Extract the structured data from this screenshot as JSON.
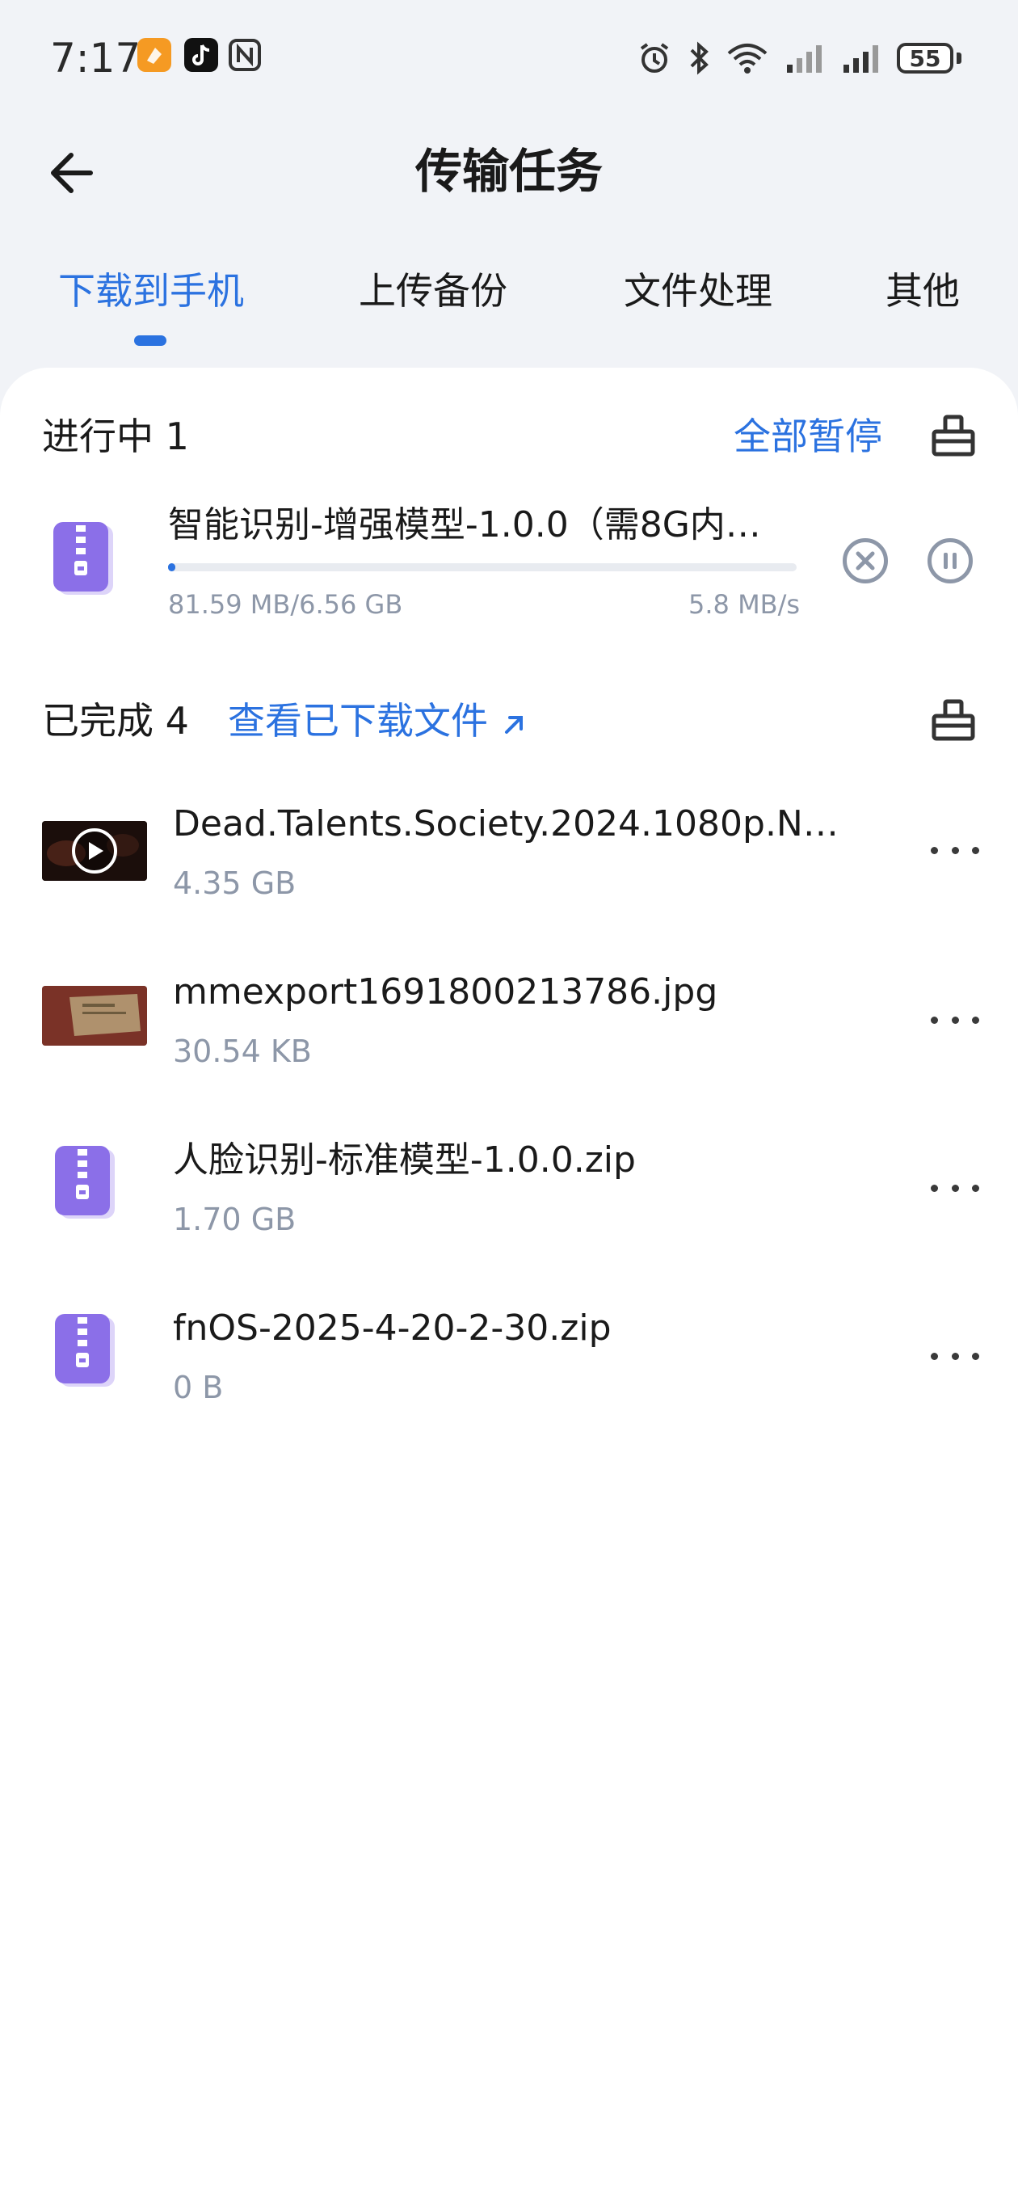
{
  "status_bar": {
    "time": "7:17",
    "battery": "55",
    "icons": [
      "alarm-icon",
      "bluetooth-icon",
      "wifi-icon",
      "signal-icon",
      "signal-icon"
    ]
  },
  "header": {
    "title": "传输任务",
    "back_icon": "arrow-left-icon"
  },
  "tabs": [
    {
      "label": "下载到手机",
      "active": true
    },
    {
      "label": "上传备份",
      "active": false
    },
    {
      "label": "文件处理",
      "active": false
    },
    {
      "label": "其他",
      "active": false
    }
  ],
  "in_progress": {
    "label": "进行中 1",
    "pause_all": "全部暂停",
    "items": [
      {
        "name": "智能识别-增强模型-1.0.0（需8G内…",
        "progress_text": "81.59 MB/6.56 GB",
        "speed": "5.8 MB/s",
        "progress_fraction": 0.012
      }
    ]
  },
  "completed": {
    "label": "已完成 4",
    "view_link": "查看已下载文件",
    "items": [
      {
        "name": "Dead.Talents.Society.2024.1080p.N…",
        "size": "4.35 GB",
        "type": "video"
      },
      {
        "name": "mmexport1691800213786.jpg",
        "size": "30.54 KB",
        "type": "image"
      },
      {
        "name": "人脸识别-标准模型-1.0.0.zip",
        "size": "1.70 GB",
        "type": "zip"
      },
      {
        "name": "fnOS-2025-4-20-2-30.zip",
        "size": "0 B",
        "type": "zip"
      }
    ]
  },
  "colors": {
    "accent": "#2b72e0",
    "zip": "#8b6fe8",
    "secondary_text": "#8d97a8"
  }
}
